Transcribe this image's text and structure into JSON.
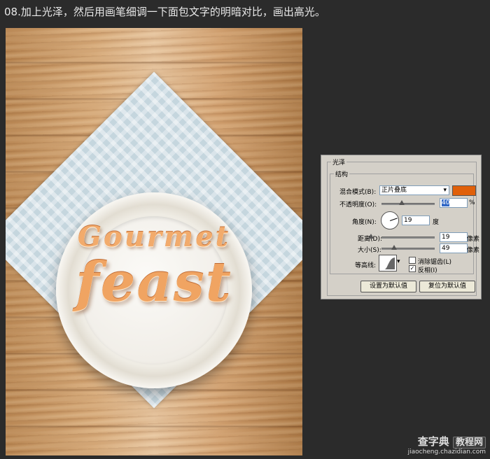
{
  "title": "08.加上光泽，然后用画笔细调一下面包文字的明暗对比，画出高光。",
  "artwork": {
    "line1": "Gourmet",
    "line2": "feast"
  },
  "panel": {
    "group_title": "光泽",
    "sub_title": "结构",
    "blend_mode_label": "混合模式(B):",
    "blend_mode_value": "正片叠底",
    "blend_color": "#e0600a",
    "opacity_label": "不透明度(O):",
    "opacity_value": "40",
    "opacity_unit": "%",
    "angle_label": "角度(N):",
    "angle_value": "19",
    "angle_unit": "度",
    "distance_label": "距离(D):",
    "distance_value": "19",
    "distance_unit": "像素",
    "size_label": "大小(S):",
    "size_value": "49",
    "size_unit": "像素",
    "contour_label": "等高线:",
    "antialias_label": "消除锯齿(L)",
    "antialias_checked": false,
    "invert_label": "反相(I)",
    "invert_checked": true,
    "set_default_btn": "设置为默认值",
    "reset_default_btn": "复位为默认值"
  },
  "watermark": {
    "brand": "查字典",
    "brand2": "教程网",
    "url": "jiaocheng.chazidian.com"
  }
}
